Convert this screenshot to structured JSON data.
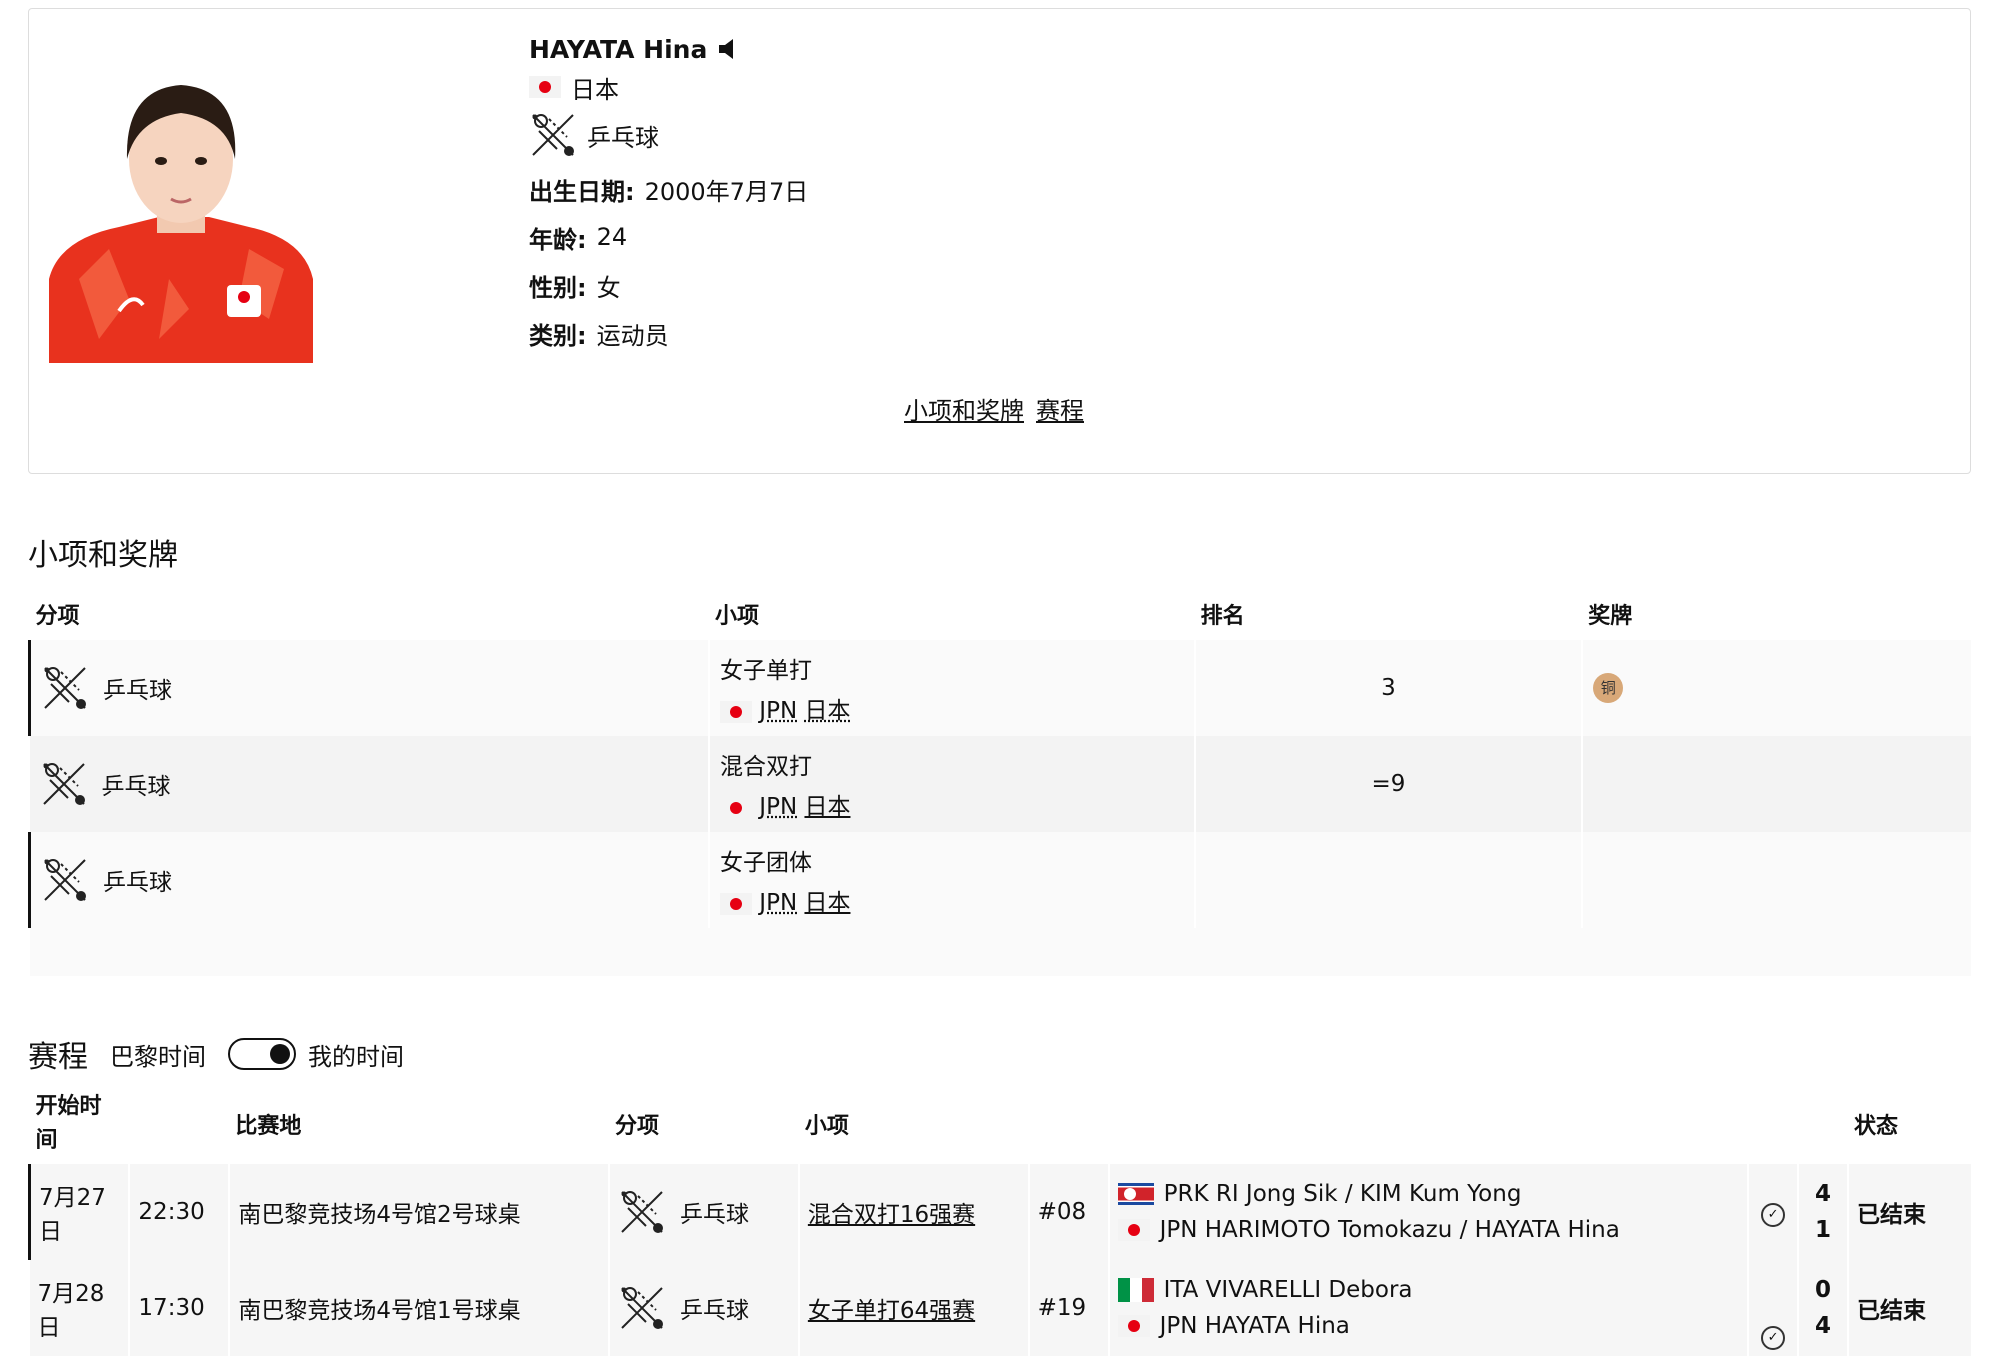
{
  "athlete": {
    "name": "HAYATA Hina",
    "country": "日本",
    "sport": "乒乓球",
    "birth_label": "出生日期:",
    "birth_value": "2000年7月7日",
    "age_label": "年龄:",
    "age_value": "24",
    "gender_label": "性别:",
    "gender_value": "女",
    "type_label": "类别:",
    "type_value": "运动员"
  },
  "links": {
    "events": "小项和奖牌",
    "schedule": "赛程"
  },
  "events_section": {
    "title": "小项和奖牌",
    "headers": [
      "分项",
      "小项",
      "排名",
      "奖牌"
    ],
    "rows": [
      {
        "discipline": "乒乓球",
        "event": "女子单打",
        "noc": "JPN",
        "country": "日本",
        "rank": "3",
        "medal": "铜"
      },
      {
        "discipline": "乒乓球",
        "event": "混合双打",
        "noc": "JPN",
        "country": "日本",
        "rank": "=9",
        "medal": ""
      },
      {
        "discipline": "乒乓球",
        "event": "女子团体",
        "noc": "JPN",
        "country": "日本",
        "rank": "",
        "medal": ""
      }
    ]
  },
  "schedule_section": {
    "title": "赛程",
    "toggle_left": "巴黎时间",
    "toggle_right": "我的时间",
    "headers": {
      "start": "开始时间",
      "venue": "比赛地",
      "discipline": "分项",
      "event": "小项",
      "status": "状态"
    },
    "rows": [
      {
        "date": "7月27日",
        "time": "22:30",
        "venue": "南巴黎竞技场4号馆2号球桌",
        "discipline": "乒乓球",
        "event": "混合双打16强赛",
        "match": "#08",
        "team1": "PRK RI Jong Sik / KIM Kum Yong",
        "team2": "JPN HARIMOTO Tomokazu / HAYATA Hina",
        "score1": "4",
        "score2": "1",
        "status": "已结束"
      },
      {
        "date": "7月28日",
        "time": "17:30",
        "venue": "南巴黎竞技场4号馆1号球桌",
        "discipline": "乒乓球",
        "event": "女子单打64强赛",
        "match": "#19",
        "team1": "ITA VIVARELLI Debora",
        "team2": "JPN HAYATA Hina",
        "score1": "0",
        "score2": "4",
        "status": "已结束"
      }
    ]
  },
  "colors": {
    "medal_bronze": "#d8a878",
    "japan_red": "#e60012"
  }
}
